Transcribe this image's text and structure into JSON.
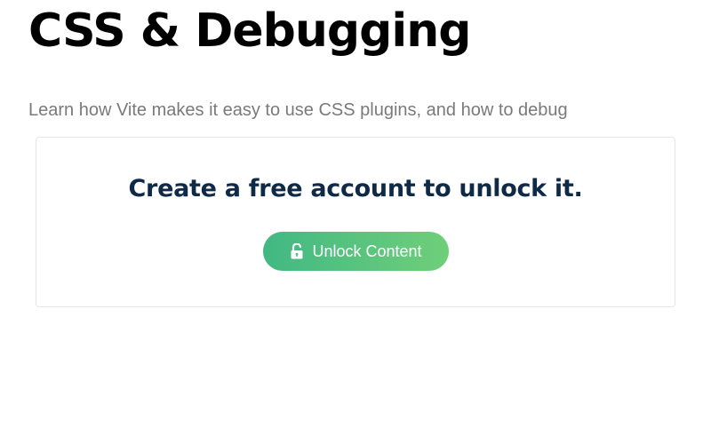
{
  "lesson": {
    "title": "CSS & Debugging",
    "subtitle": "Learn how Vite makes it easy to use CSS plugins, and how to debug"
  },
  "unlock_card": {
    "heading": "Create a free account to unlock it.",
    "button_label": "Unlock Content",
    "button_icon": "unlock-icon"
  },
  "colors": {
    "title": "#000000",
    "subtitle": "#7a7a7a",
    "heading": "#0f2a47",
    "button_gradient_start": "#41b883",
    "button_gradient_end": "#6fcf7a",
    "card_border": "#e6e6e6"
  }
}
